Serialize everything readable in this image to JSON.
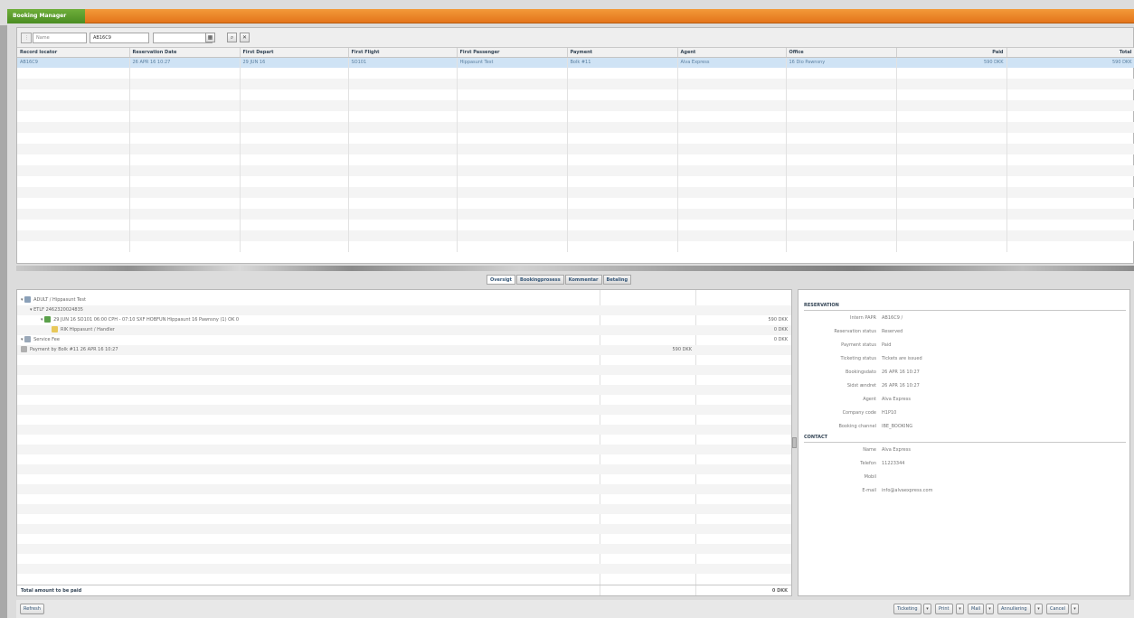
{
  "window": {
    "title": "Booking Manager"
  },
  "search": {
    "name_placeholder": "Name",
    "locator_value": "AB16C9",
    "third_value": ""
  },
  "grid": {
    "columns": [
      "Record locator",
      "Reservation Date",
      "First Depart",
      "First Flight",
      "First Passenger",
      "Payment",
      "Agent",
      "Office",
      "Paid",
      "Total"
    ],
    "rows": [
      [
        "AB16C9",
        "26 APR 16 10:27",
        "29 JUN 16",
        "SO101",
        "Hippasunt Test",
        "Bolk #11",
        "Alva Express",
        "16 Dio Pawnsny",
        "590 DKK",
        "590 DKK"
      ]
    ]
  },
  "tabs": [
    "Oversigt",
    "Bookingprosess",
    "Kommentar",
    "Betaling"
  ],
  "tree": [
    {
      "indent": 0,
      "icon": "person",
      "text": "ADULT / Hippasunt Test",
      "amt1": "",
      "amt2": ""
    },
    {
      "indent": 1,
      "icon": "none",
      "text": "ETLF 2462320024835",
      "amt1": "",
      "amt2": ""
    },
    {
      "indent": 2,
      "icon": "ticket",
      "text": "29 JUN 16  SO101  06:00 CPH - 07:10 SXF  HOBFUN Hippasunt 16 Pawnsny (1)  OK  0",
      "amt1": "",
      "amt2": "590 DKK"
    },
    {
      "indent": 3,
      "icon": "folder",
      "text": "RIK Hippasunt / Handler",
      "amt1": "",
      "amt2": "0 DKK"
    },
    {
      "indent": 0,
      "icon": "fee",
      "text": "Service Fee",
      "amt1": "",
      "amt2": "0 DKK"
    },
    {
      "indent": 0,
      "icon": "doc",
      "text": "Payment by Bolk #11 26 APR 16  10:27",
      "amt1": "590 DKK",
      "amt2": ""
    }
  ],
  "total": {
    "label": "Total amount to be paid",
    "value": "0 DKK"
  },
  "reservation": {
    "title": "RESERVATION",
    "fields": [
      {
        "k": "Intern PAPR",
        "v": "AB16C9 /"
      },
      {
        "k": "Reservation status",
        "v": "Reserved"
      },
      {
        "k": "Payment status",
        "v": "Paid"
      },
      {
        "k": "Ticketing status",
        "v": "Tickets are issued"
      },
      {
        "k": "Bookingsdato",
        "v": "26 APR 16  10:27"
      },
      {
        "k": "Sidst ændret",
        "v": "26 APR 16  10:27"
      },
      {
        "k": "Agent",
        "v": "Alva Express"
      },
      {
        "k": "Company code",
        "v": "H1P10"
      },
      {
        "k": "Booking channel",
        "v": "IBE_BOOKING"
      }
    ]
  },
  "contact": {
    "title": "CONTACT",
    "fields": [
      {
        "k": "Name",
        "v": "Alva Express"
      },
      {
        "k": "Telefon",
        "v": "11223344"
      },
      {
        "k": "Mobil",
        "v": ""
      },
      {
        "k": "E-mail",
        "v": "info@alvaexpress.com"
      }
    ]
  },
  "bottom": {
    "refresh": "Refresh",
    "buttons": [
      "Ticketing",
      "Print",
      "Mail",
      "Annullering",
      "Cancel"
    ]
  }
}
